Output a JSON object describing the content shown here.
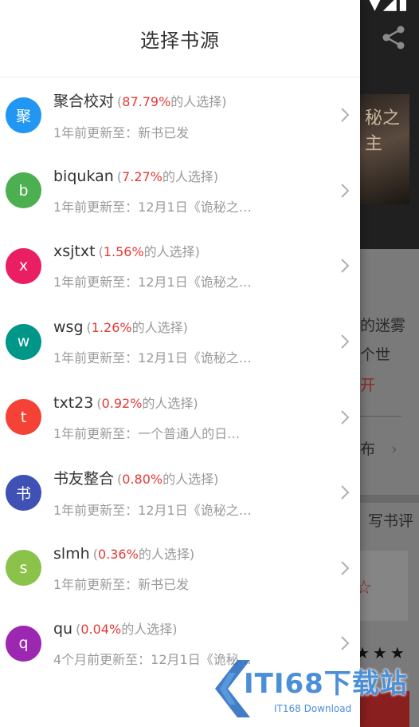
{
  "drawer": {
    "title": "选择书源",
    "pick_suffix": "的人选择"
  },
  "sources": [
    {
      "avatar": "聚",
      "avatar_color": "#2196f3",
      "name": "聚合校对",
      "percent": "87.79%",
      "update": "1年前更新至：新书已发"
    },
    {
      "avatar": "b",
      "avatar_color": "#4caf50",
      "name": "biqukan",
      "percent": "7.27%",
      "update": "1年前更新至：12月1日《诡秘之…"
    },
    {
      "avatar": "x",
      "avatar_color": "#e91e63",
      "name": "xsjtxt",
      "percent": "1.56%",
      "update": "1年前更新至：12月1日《诡秘之…"
    },
    {
      "avatar": "w",
      "avatar_color": "#009688",
      "name": "wsg",
      "percent": "1.26%",
      "update": "1年前更新至：12月1日《诡秘之…"
    },
    {
      "avatar": "t",
      "avatar_color": "#f44336",
      "name": "txt23",
      "percent": "0.92%",
      "update": "1年前更新至：一个普通人的日…"
    },
    {
      "avatar": "书",
      "avatar_color": "#3f51b5",
      "name": "书友整合",
      "percent": "0.80%",
      "update": "1年前更新至：12月1日《诡秘之…"
    },
    {
      "avatar": "s",
      "avatar_color": "#8bc34a",
      "name": "slmh",
      "percent": "0.36%",
      "update": "1年前更新至：新书已发"
    },
    {
      "avatar": "q",
      "avatar_color": "#9c27b0",
      "name": "qu",
      "percent": "0.04%",
      "update": "4个月前更新至：12月1日《诡秘…"
    }
  ],
  "background": {
    "status": "▼◢▮",
    "cover_text": "秘之主",
    "text_line1": "的迷雾",
    "text_line2": "个世",
    "text_red": "开",
    "text_publish": "布",
    "text_review": "写书评",
    "stars": "★★★"
  },
  "watermark": {
    "brand": "ITI68下载站",
    "sub": "IT168 Download"
  }
}
